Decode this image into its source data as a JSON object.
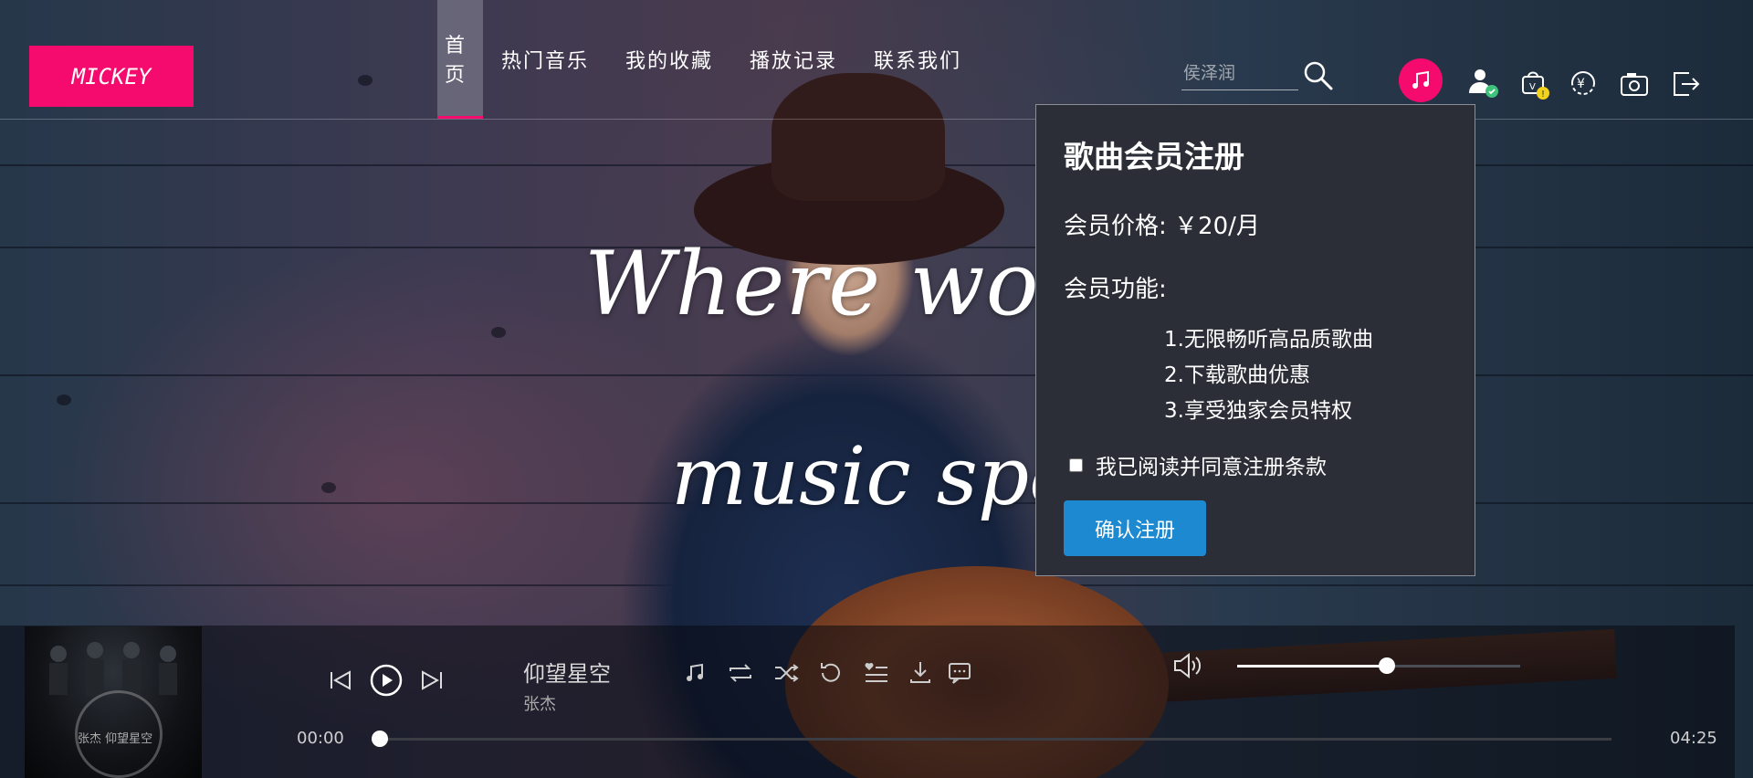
{
  "brand": {
    "logo": "MICKEY",
    "accent": "#f50b6d",
    "link_blue": "#1d89d0"
  },
  "nav": {
    "items": [
      {
        "label": "首 页",
        "active": true
      },
      {
        "label": "热门音乐"
      },
      {
        "label": "我的收藏"
      },
      {
        "label": "播放记录"
      },
      {
        "label": "联系我们"
      }
    ]
  },
  "search": {
    "placeholder": "侯泽润",
    "icon": "search-icon"
  },
  "header_icons": [
    "music-note-icon",
    "user-icon",
    "vip-bag-icon",
    "yuan-coin-icon",
    "camera-icon",
    "logout-icon"
  ],
  "hero": {
    "line1": "Where words",
    "line2": "music speak"
  },
  "popup": {
    "title": "歌曲会员注册",
    "price_label": "会员价格: ￥20/月",
    "features_title": "会员功能:",
    "features": [
      "1.无限畅听高品质歌曲",
      "2.下载歌曲优惠",
      "3.享受独家会员特权"
    ],
    "agree_label": "我已阅读并同意注册条款",
    "agree_checked": false,
    "confirm_label": "确认注册"
  },
  "player": {
    "song_title": "仰望星空",
    "artist": "张杰",
    "current_time": "00:00",
    "total_time": "04:25",
    "progress": 0.0,
    "volume": 0.53,
    "cover_text": "张杰 仰望星空"
  }
}
